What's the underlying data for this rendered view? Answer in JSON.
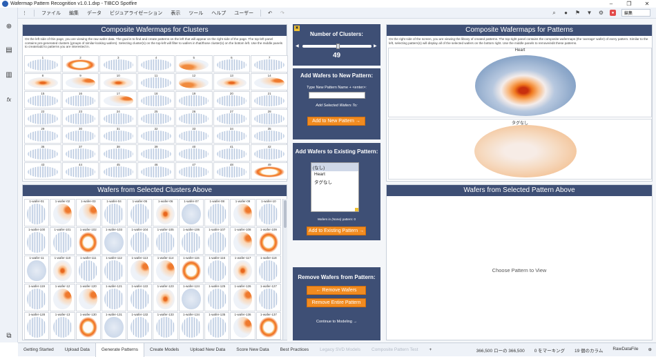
{
  "window": {
    "title": "Wafermap Pattern Recognition v1.0.1.dxp - TIBCO Spotfire",
    "controls": [
      "–",
      "❐",
      "✕"
    ]
  },
  "menu": [
    "ファイル",
    "編集",
    "データ",
    "ビジュアライゼーション",
    "表示",
    "ツール",
    "ヘルプ",
    "ユーザー"
  ],
  "menu_right": {
    "edit_label": "編集"
  },
  "left": {
    "title": "Composite Wafermaps for Clusters",
    "description": "On the left side of this page, you are viewing the raw wafer data. The goal is to find and create patterns on the left that will appear on the right side of the page. The top-left panel contains pre-generated clusters (groups of similar-looking wafers). Selecting cluster(s) on the top-left will filter to wafers in that/those cluster(s) on the bottom left. Use the middle panels to create/add to patterns you are interested in.",
    "clusters": [
      "1",
      "2",
      "3",
      "4",
      "5",
      "6",
      "7",
      "8",
      "9",
      "10",
      "11",
      "12",
      "13",
      "14",
      "15",
      "16",
      "17",
      "18",
      "19",
      "20",
      "21",
      "22",
      "23",
      "24",
      "25",
      "26",
      "27",
      "28",
      "29",
      "30",
      "31",
      "32",
      "33",
      "34",
      "35",
      "36",
      "37",
      "38",
      "39",
      "40",
      "41",
      "42",
      "43",
      "44",
      "45",
      "46",
      "47",
      "48",
      "49"
    ],
    "wafers_title": "Wafers from Selected Clusters Above",
    "wafers": [
      "1-wafer-01",
      "1-wafer-02",
      "1-wafer-03",
      "1-wafer-04",
      "1-wafer-05",
      "1-wafer-06",
      "1-wafer-07",
      "1-wafer-08",
      "1-wafer-09",
      "1-wafer-10",
      "1-wafer-100",
      "1-wafer-101",
      "1-wafer-102",
      "1-wafer-103",
      "1-wafer-104",
      "1-wafer-105",
      "1-wafer-106",
      "1-wafer-107",
      "1-wafer-108",
      "1-wafer-109",
      "1-wafer-11",
      "1-wafer-110",
      "1-wafer-111",
      "1-wafer-112",
      "1-wafer-113",
      "1-wafer-114",
      "1-wafer-115",
      "1-wafer-116",
      "1-wafer-117",
      "1-wafer-118",
      "1-wafer-119",
      "1-wafer-12",
      "1-wafer-120",
      "1-wafer-121",
      "1-wafer-122",
      "1-wafer-123",
      "1-wafer-124",
      "1-wafer-125",
      "1-wafer-126",
      "1-wafer-127",
      "1-wafer-128",
      "1-wafer-13",
      "1-wafer-130",
      "1-wafer-131",
      "1-wafer-132",
      "1-wafer-133",
      "1-wafer-134",
      "1-wafer-135",
      "1-wafer-136",
      "1-wafer-137"
    ]
  },
  "middle": {
    "clusters_label": "Number of Clusters:",
    "clusters_value": "49",
    "new_pattern_title": "Add Wafers to New Pattern:",
    "new_pattern_name_label": "Type New Pattern Name + <enter>:",
    "add_selected_label": "Add Selected Wafers To:",
    "add_new_button": "Add to New Pattern →",
    "existing_title": "Add Wafers to Existing Pattern:",
    "existing_options": [
      "(なし)",
      "Heart",
      "タグなし"
    ],
    "wafers_in_label": "Wafers in",
    "wafers_in_value": "(None)",
    "wafers_in_suffix": "pattern: 0",
    "add_existing_button": "Add to Existing Pattern →",
    "remove_title": "Remove Wafers from Pattern:",
    "remove_wafers_button": "← Remove Wafers",
    "remove_pattern_button": "Remove Entire Pattern",
    "continue_label": "Continue to Modeling →"
  },
  "right": {
    "title": "Composite Wafermaps for Patterns",
    "description": "On the right side of the screen, you are viewing the library of created patterns. The top-right panel contains the composite wafermaps (the 'average' wafer) of every pattern. Similar to the left, selecting pattern(s) will display all of the selected wafers on the bottom right. Use the middle panels to remove/edit these patterns.",
    "patterns": [
      "Heart",
      "タグなし"
    ],
    "wafers_title": "Wafers from Selected Pattern Above",
    "empty_message": "Choose Pattern to View"
  },
  "tabs": [
    "Getting Started",
    "Upload Data",
    "Generate Patterns",
    "Create Models",
    "Upload New Data",
    "Score New Data",
    "Best Practices",
    "Legacy SVD Models",
    "Composite Pattern Test"
  ],
  "active_tab": "Generate Patterns",
  "status": [
    "366,500 ローの 366,500",
    "0 をマーキング",
    "19 個のカラム",
    "RawDataFile"
  ]
}
